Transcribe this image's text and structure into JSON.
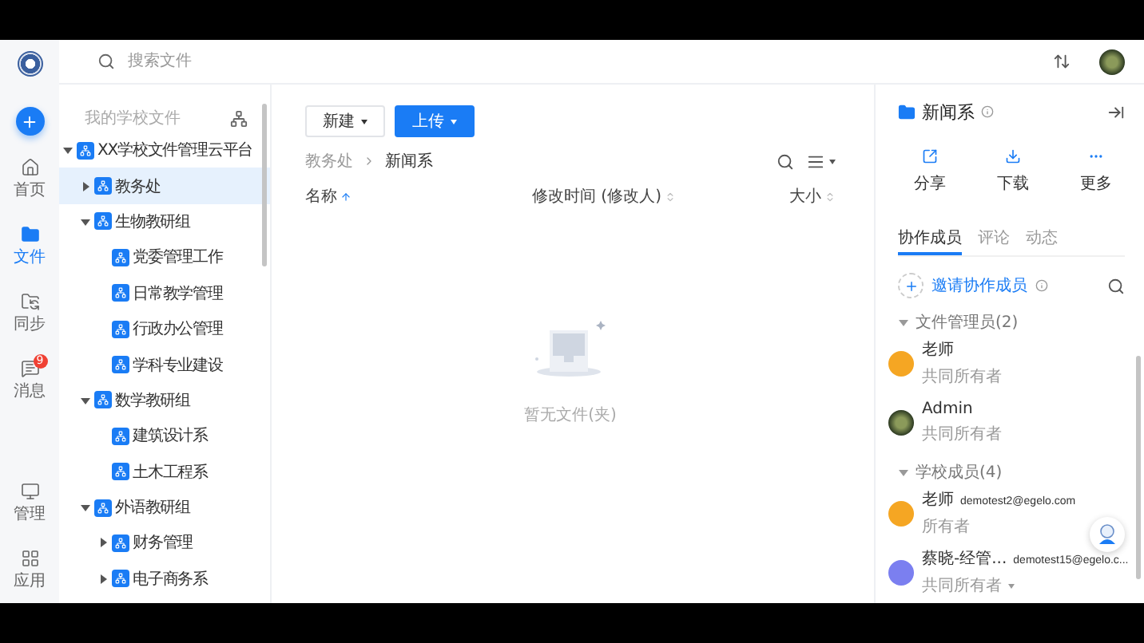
{
  "top_bar": {
    "search": {
      "placeholder": "搜索文件"
    }
  },
  "nav": [
    {
      "kind": "home",
      "label": "首页",
      "selected": false
    },
    {
      "kind": "files",
      "label": "文件",
      "selected": true
    },
    {
      "kind": "sync",
      "label": "同步",
      "selected": false
    },
    {
      "kind": "messages",
      "label": "消息",
      "selected": false,
      "badge": "9"
    },
    {
      "kind": "admin",
      "label": "管理",
      "selected": false
    },
    {
      "kind": "apps",
      "label": "应用",
      "selected": false
    }
  ],
  "tree": {
    "title": "我的学校文件",
    "items": [
      {
        "label": "XX学校文件管理云平台",
        "expanded": true,
        "selected": false,
        "children": [
          {
            "label": "教务处",
            "expanded": false,
            "selected": true
          },
          {
            "label": "生物教研组",
            "expanded": true,
            "selected": false,
            "children": [
              {
                "label": "党委管理工作",
                "selected": false
              },
              {
                "label": "日常教学管理",
                "selected": false
              },
              {
                "label": "行政办公管理",
                "selected": false
              },
              {
                "label": "学科专业建设",
                "selected": false
              }
            ]
          },
          {
            "label": "数学教研组",
            "expanded": true,
            "selected": false,
            "children": [
              {
                "label": "建筑设计系",
                "selected": false
              },
              {
                "label": "土木工程系",
                "selected": false
              }
            ]
          },
          {
            "label": "外语教研组",
            "expanded": true,
            "selected": false,
            "children": [
              {
                "label": "财务管理",
                "expanded": false,
                "selected": false
              },
              {
                "label": "电子商务系",
                "expanded": false,
                "selected": false
              }
            ]
          }
        ]
      }
    ]
  },
  "main": {
    "buttons": [
      {
        "label": "新建",
        "kind": "default"
      },
      {
        "label": "上传",
        "kind": "primary"
      }
    ],
    "breadcrumb": [
      "教务处",
      "新闻系"
    ],
    "columns": [
      {
        "label": "名称",
        "sorted": true
      },
      {
        "label": "修改时间 (修改人)",
        "sorted": false
      },
      {
        "label": "大小",
        "sorted": false
      }
    ],
    "empty_text": "暂无文件(夹)"
  },
  "details": {
    "title": "新闻系",
    "actions": [
      {
        "kind": "share",
        "label": "分享"
      },
      {
        "kind": "download",
        "label": "下载"
      },
      {
        "kind": "more",
        "label": "更多"
      }
    ],
    "tabs": [
      {
        "label": "协作成员",
        "selected": true
      },
      {
        "label": "评论",
        "selected": false
      },
      {
        "label": "动态",
        "selected": false
      }
    ],
    "invite": "邀请协作成员",
    "groups": [
      {
        "title": "文件管理员(2)",
        "expanded": true,
        "members": [
          {
            "name": "老师",
            "role": "共同所有者",
            "color": "#f5a623"
          },
          {
            "name": "Admin",
            "role": "共同所有者"
          }
        ]
      },
      {
        "title": "学校成员(4)",
        "expanded": true,
        "members": [
          {
            "name": "老师",
            "email": "demotest2@egelo.com",
            "role": "所有者",
            "color": "#f5a623"
          },
          {
            "name": "蔡晓-经管...",
            "email": "demotest15@egelo.c...",
            "role": "共同所有者",
            "role_menu": true,
            "color": "#7b7ff0"
          }
        ]
      }
    ]
  }
}
